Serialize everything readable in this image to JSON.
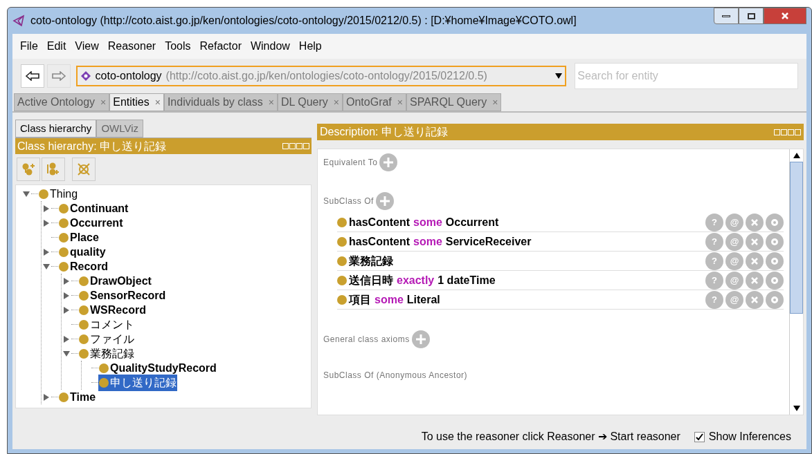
{
  "window": {
    "title": "coto-ontology (http://coto.aist.go.jp/ken/ontologies/coto-ontology/2015/0212/0.5)  : [D:¥home¥Image¥COTO.owl]"
  },
  "menu": [
    "File",
    "Edit",
    "View",
    "Reasoner",
    "Tools",
    "Refactor",
    "Window",
    "Help"
  ],
  "toolbar": {
    "ontology_name": "coto-ontology",
    "ontology_iri": "(http://coto.aist.go.jp/ken/ontologies/coto-ontology/2015/0212/0.5)",
    "search": {
      "placeholder": "Search for entity"
    }
  },
  "tabs": [
    {
      "label": "Active Ontology",
      "selected": false
    },
    {
      "label": "Entities",
      "selected": true
    },
    {
      "label": "Individuals by class",
      "selected": false
    },
    {
      "label": "DL Query",
      "selected": false
    },
    {
      "label": "OntoGraf",
      "selected": false
    },
    {
      "label": "SPARQL Query",
      "selected": false
    }
  ],
  "close_glyph": "×",
  "left": {
    "tabs": [
      {
        "label": "Class hierarchy",
        "selected": true
      },
      {
        "label": "OWLViz",
        "selected": false
      }
    ],
    "header": "Class hierarchy: 申し送り記録",
    "tree": [
      {
        "label": "Thing",
        "bold": false,
        "expanded": true,
        "selected": false,
        "children": [
          {
            "label": "Continuant",
            "bold": true,
            "expanded": false,
            "selected": false
          },
          {
            "label": "Occurrent",
            "bold": true,
            "expanded": false,
            "selected": false
          },
          {
            "label": "Place",
            "bold": true,
            "selected": false
          },
          {
            "label": "quality",
            "bold": true,
            "expanded": false,
            "selected": false
          },
          {
            "label": "Record",
            "bold": true,
            "expanded": true,
            "selected": false,
            "children": [
              {
                "label": "DrawObject",
                "bold": true,
                "expanded": false,
                "selected": false
              },
              {
                "label": "SensorRecord",
                "bold": true,
                "expanded": false,
                "selected": false
              },
              {
                "label": "WSRecord",
                "bold": true,
                "expanded": false,
                "selected": false
              },
              {
                "label": "コメント",
                "bold": false,
                "selected": false
              },
              {
                "label": "ファイル",
                "bold": false,
                "expanded": false,
                "selected": false
              },
              {
                "label": "業務記録",
                "bold": false,
                "expanded": true,
                "selected": false,
                "children": [
                  {
                    "label": "QualityStudyRecord",
                    "bold": true,
                    "selected": false
                  },
                  {
                    "label": "申し送り記録",
                    "bold": false,
                    "selected": true
                  }
                ]
              }
            ]
          },
          {
            "label": "Time",
            "bold": true,
            "expanded": false,
            "selected": false
          }
        ]
      }
    ]
  },
  "description": {
    "header": "Description: 申し送り記録",
    "sections": [
      {
        "title": "Equivalent To"
      },
      {
        "title": "SubClass Of",
        "axioms": [
          [
            {
              "text": "hasContent",
              "keyword": false
            },
            {
              "text": "some",
              "keyword": true
            },
            {
              "text": "Occurrent",
              "keyword": false
            }
          ],
          [
            {
              "text": "hasContent",
              "keyword": false
            },
            {
              "text": "some",
              "keyword": true
            },
            {
              "text": "ServiceReceiver",
              "keyword": false
            }
          ],
          [
            {
              "text": "業務記録",
              "keyword": false
            }
          ],
          [
            {
              "text": "送信日時",
              "keyword": false
            },
            {
              "text": "exactly",
              "keyword": true
            },
            {
              "text": "1 dateTime",
              "keyword": false
            }
          ],
          [
            {
              "text": "項目",
              "keyword": false
            },
            {
              "text": "some",
              "keyword": true
            },
            {
              "text": "Literal",
              "keyword": false
            }
          ]
        ]
      },
      {
        "title": "General class axioms"
      },
      {
        "title": "SubClass Of (Anonymous Ancestor)"
      }
    ],
    "axiom_buttons": [
      "?",
      "@"
    ]
  },
  "status": {
    "text": "To use the reasoner click Reasoner ➔ Start reasoner",
    "show_inferences": {
      "label": "Show Inferences",
      "checked": true
    }
  }
}
